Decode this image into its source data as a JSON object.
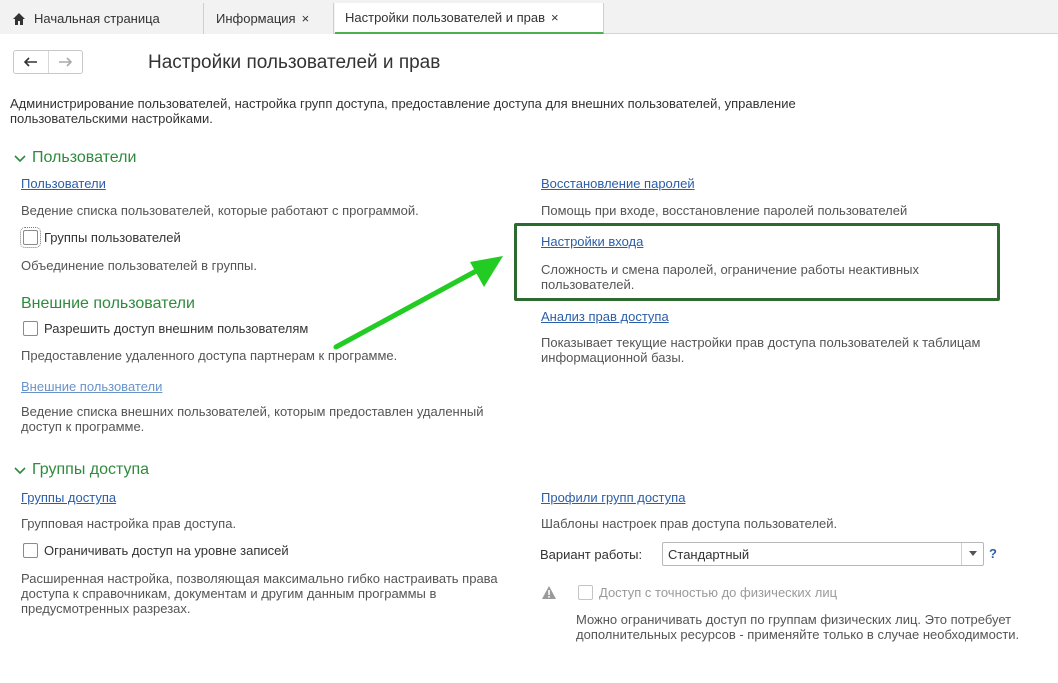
{
  "tabs": {
    "home": "Начальная страница",
    "info": "Информация",
    "settings": "Настройки пользователей и прав",
    "close_glyph": "×"
  },
  "page": {
    "title": "Настройки пользователей и прав",
    "description": "Администрирование пользователей, настройка групп доступа, предоставление доступа для внешних пользователей, управление пользовательскими настройками."
  },
  "users_section": {
    "title": "Пользователи",
    "users_link": "Пользователи",
    "users_note": "Ведение списка пользователей, которые работают с программой.",
    "groups_checkbox": "Группы пользователей",
    "groups_note": "Объединение пользователей в группы.",
    "external_title": "Внешние пользователи",
    "external_checkbox": "Разрешить доступ внешним пользователям",
    "external_note": "Предоставление удаленного доступа партнерам к программе.",
    "external_link": "Внешние пользователи",
    "external_link_note": "Ведение списка внешних пользователей, которым предоставлен удаленный доступ к программе.",
    "password_recovery_link": "Восстановление паролей",
    "password_recovery_note": "Помощь при входе, восстановление паролей пользователей",
    "login_settings_link": "Настройки входа",
    "login_settings_note": "Сложность и смена паролей, ограничение работы неактивных пользователей.",
    "rights_analysis_link": "Анализ прав доступа",
    "rights_analysis_note": "Показывает текущие настройки прав доступа пользователей к таблицам информационной базы."
  },
  "access_section": {
    "title": "Группы доступа",
    "groups_link": "Группы доступа",
    "groups_note": "Групповая настройка прав доступа.",
    "restrict_checkbox": "Ограничивать доступ на уровне записей",
    "restrict_note": "Расширенная настройка, позволяющая максимально гибко настраивать права доступа к справочникам, документам и другим данным программы в предусмотренных разрезах.",
    "profiles_link": "Профили групп доступа",
    "profiles_note": "Шаблоны настроек прав доступа пользователей.",
    "variant_label": "Вариант работы:",
    "variant_value": "Стандартный",
    "help_glyph": "?",
    "individuals_checkbox": "Доступ с точностью до физических лиц",
    "individuals_note": "Можно ограничивать доступ по группам физических лиц. Это потребует дополнительных ресурсов - применяйте только в случае необходимости."
  },
  "colors": {
    "accent_green": "#2e8b3d",
    "link_blue": "#2b5ea8",
    "highlight_border": "#2d6a2f",
    "arrow_green": "#22cc22"
  }
}
